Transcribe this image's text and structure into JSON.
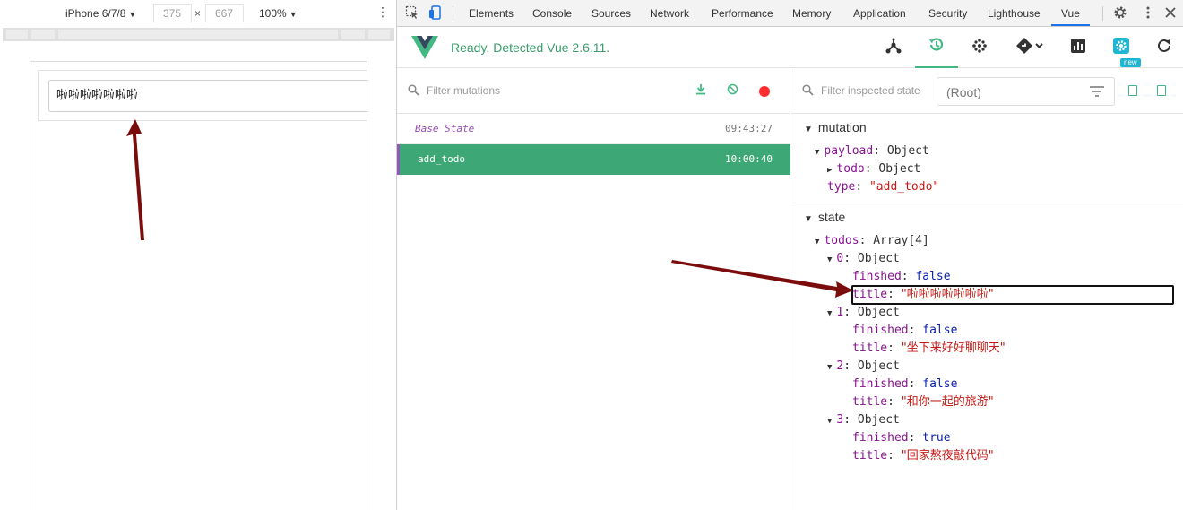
{
  "device_toolbar": {
    "device": "iPhone 6/7/8",
    "width": "375",
    "height": "667",
    "times": "×",
    "zoom": "100%",
    "caret": "▼",
    "more": "⋮"
  },
  "preview": {
    "todo_input_value": "啦啦啦啦啦啦啦"
  },
  "devtools_tabs": [
    "Elements",
    "Console",
    "Sources",
    "Network",
    "Performance",
    "Memory",
    "Application",
    "Security",
    "Lighthouse",
    "Vue"
  ],
  "vue": {
    "status": "Ready. Detected Vue 2.6.11.",
    "new_badge": "new",
    "accent": "#42b983"
  },
  "mutations": {
    "filter_placeholder": "Filter mutations",
    "items": [
      {
        "name": "Base State",
        "time": "09:43:27"
      },
      {
        "name": "add_todo",
        "time": "10:00:40"
      }
    ]
  },
  "state_panel": {
    "filter_placeholder": "Filter inspected state",
    "root_label": "(Root)",
    "mutation_section": "mutation",
    "state_section": "state",
    "payload_key": "payload",
    "payload_val": "Object",
    "todo_key": "todo",
    "todo_val": "Object",
    "type_key": "type",
    "type_val": "\"add_todo\"",
    "todos_key": "todos",
    "todos_val": "Array[4]",
    "object_label": "Object",
    "items": [
      {
        "idx": "0",
        "finished_key": "finshed",
        "finished": "false",
        "title": "\"啦啦啦啦啦啦啦\""
      },
      {
        "idx": "1",
        "finished_key": "finished",
        "finished": "false",
        "title": "\"坐下来好好聊聊天\""
      },
      {
        "idx": "2",
        "finished_key": "finished",
        "finished": "false",
        "title": "\"和你一起的旅游\""
      },
      {
        "idx": "3",
        "finished_key": "finished",
        "finished": "true",
        "title": "\"回家熬夜敲代码\""
      }
    ],
    "title_key": "title"
  }
}
